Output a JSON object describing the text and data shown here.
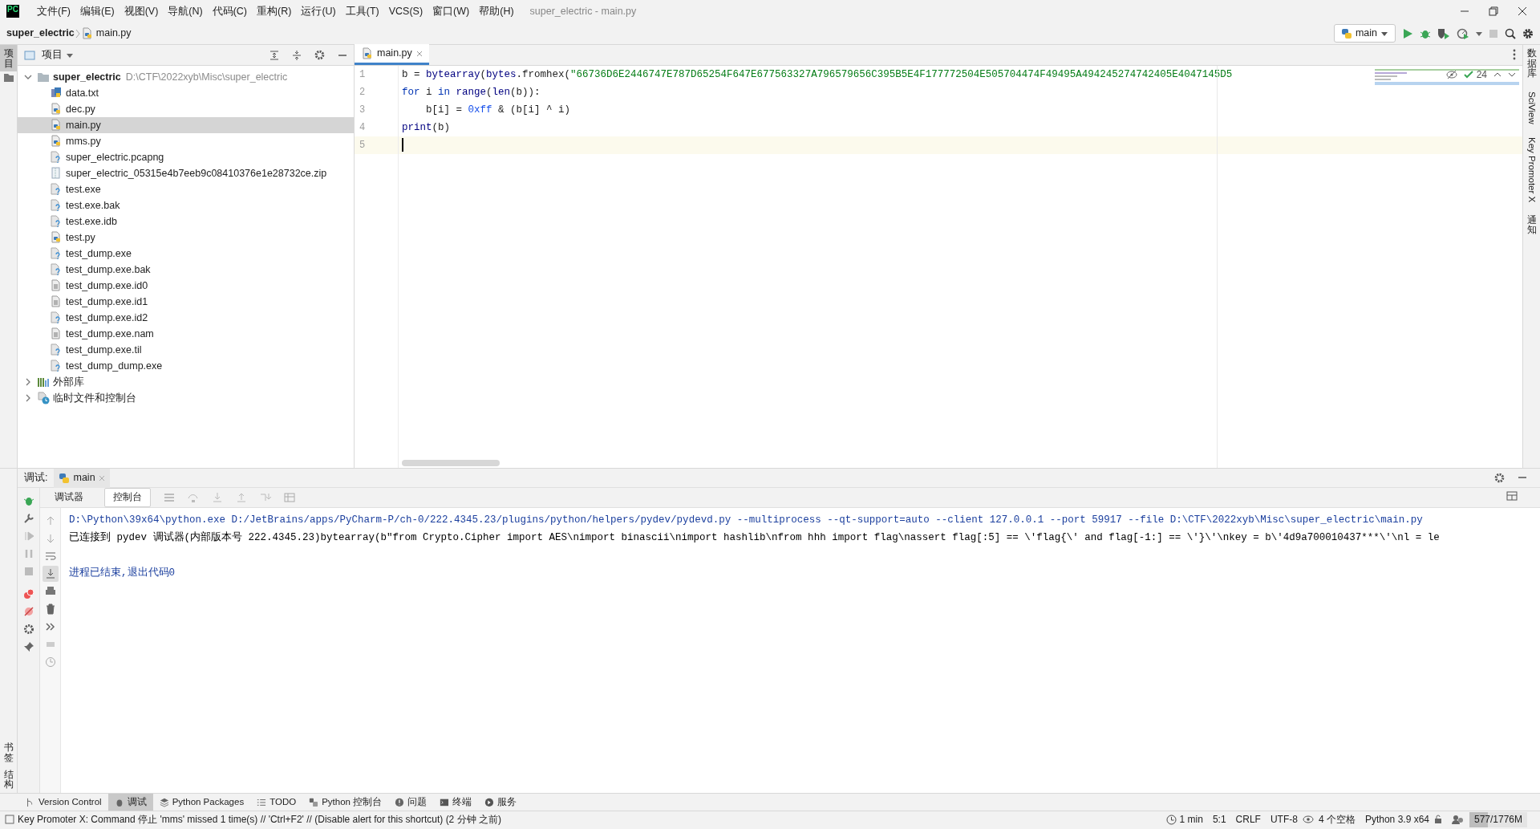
{
  "window": {
    "logo": "PC",
    "title": "super_electric - main.py"
  },
  "menu": [
    "文件(F)",
    "编辑(E)",
    "视图(V)",
    "导航(N)",
    "代码(C)",
    "重构(R)",
    "运行(U)",
    "工具(T)",
    "VCS(S)",
    "窗口(W)",
    "帮助(H)"
  ],
  "breadcrumb": [
    "super_electric",
    "main.py"
  ],
  "run_config": "main",
  "left_stripe": {
    "top": [
      {
        "label": "项目",
        "selected": true
      }
    ],
    "bottom": [
      {
        "label": "书签",
        "selected": false
      },
      {
        "label": "结构",
        "selected": false
      }
    ]
  },
  "project": {
    "title": "项目",
    "tree": [
      {
        "name": "super_electric",
        "path": "D:\\CTF\\2022xyb\\Misc\\super_electric",
        "kind": "folder",
        "expanded": true,
        "selected": false,
        "children": [
          {
            "name": "data.txt",
            "kind": "data",
            "selected": false
          },
          {
            "name": "dec.py",
            "kind": "python",
            "selected": false
          },
          {
            "name": "main.py",
            "kind": "python",
            "selected": true
          },
          {
            "name": "mms.py",
            "kind": "python",
            "selected": false
          },
          {
            "name": "super_electric.pcapng",
            "kind": "unknown",
            "selected": false
          },
          {
            "name": "super_electric_05315e4b7eeb9c08410376e1e28732ce.zip",
            "kind": "archive",
            "selected": false
          },
          {
            "name": "test.exe",
            "kind": "unknown",
            "selected": false
          },
          {
            "name": "test.exe.bak",
            "kind": "unknown",
            "selected": false
          },
          {
            "name": "test.exe.idb",
            "kind": "unknown",
            "selected": false
          },
          {
            "name": "test.py",
            "kind": "python",
            "selected": false
          },
          {
            "name": "test_dump.exe",
            "kind": "unknown",
            "selected": false
          },
          {
            "name": "test_dump.exe.bak",
            "kind": "unknown",
            "selected": false
          },
          {
            "name": "test_dump.exe.id0",
            "kind": "text",
            "selected": false
          },
          {
            "name": "test_dump.exe.id1",
            "kind": "text",
            "selected": false
          },
          {
            "name": "test_dump.exe.id2",
            "kind": "unknown",
            "selected": false
          },
          {
            "name": "test_dump.exe.nam",
            "kind": "text",
            "selected": false
          },
          {
            "name": "test_dump.exe.til",
            "kind": "unknown",
            "selected": false
          },
          {
            "name": "test_dump_dump.exe",
            "kind": "unknown",
            "selected": false
          }
        ]
      },
      {
        "name": "外部库",
        "kind": "library",
        "expanded": false,
        "selected": false
      },
      {
        "name": "临时文件和控制台",
        "kind": "scratches",
        "expanded": false,
        "selected": false
      }
    ]
  },
  "editor": {
    "tab": {
      "label": "main.py",
      "selected": true
    },
    "inspection": {
      "count": "24"
    },
    "lines": [
      {
        "number": "1",
        "current": false,
        "tokens": [
          {
            "kind": "plain",
            "text": "b = "
          },
          {
            "kind": "builtin",
            "text": "bytearray"
          },
          {
            "kind": "plain",
            "text": "("
          },
          {
            "kind": "builtin",
            "text": "bytes"
          },
          {
            "kind": "plain",
            "text": ".fromhex("
          },
          {
            "kind": "string",
            "text": "\"66736D6E2446747E787D65254F647E677563327A796579656C395B5E4F177772504E505704474F49495A494245274742405E4047145D5"
          }
        ]
      },
      {
        "number": "2",
        "current": false,
        "tokens": [
          {
            "kind": "keyword",
            "text": "for"
          },
          {
            "kind": "plain",
            "text": " i "
          },
          {
            "kind": "keyword",
            "text": "in "
          },
          {
            "kind": "builtin",
            "text": "range"
          },
          {
            "kind": "plain",
            "text": "("
          },
          {
            "kind": "builtin",
            "text": "len"
          },
          {
            "kind": "plain",
            "text": "(b)):"
          }
        ]
      },
      {
        "number": "3",
        "current": false,
        "tokens": [
          {
            "kind": "plain",
            "text": "    b[i] = "
          },
          {
            "kind": "number",
            "text": "0xff"
          },
          {
            "kind": "plain",
            "text": " & (b[i] ^ i)"
          }
        ]
      },
      {
        "number": "4",
        "current": false,
        "tokens": [
          {
            "kind": "builtin",
            "text": "print"
          },
          {
            "kind": "plain",
            "text": "(b)"
          }
        ]
      },
      {
        "number": "5",
        "current": true
      }
    ]
  },
  "right_stripe": [
    {
      "label": "数据库",
      "kind": "stacked"
    },
    {
      "label": "SciView",
      "kind": "rotated"
    },
    {
      "label": "Key Promoter X",
      "kind": "rotated"
    },
    {
      "label": "通知",
      "kind": "stacked"
    }
  ],
  "debug": {
    "label": "调试:",
    "session": {
      "label": "main",
      "selected": true
    },
    "tabs": [
      {
        "label": "调试器",
        "selected": false
      },
      {
        "label": "控制台",
        "selected": true
      }
    ],
    "console": [
      {
        "kind": "command",
        "text": "D:\\Python\\39x64\\python.exe D:/JetBrains/apps/PyCharm-P/ch-0/222.4345.23/plugins/python/helpers/pydev/pydevd.py --multiprocess --qt-support=auto --client 127.0.0.1 --port 59917 --file D:\\CTF\\2022xyb\\Misc\\super_electric\\main.py"
      },
      {
        "kind": "output",
        "text": "已连接到 pydev 调试器(内部版本号 222.4345.23)bytearray(b\"from Crypto.Cipher import AES\\nimport binascii\\nimport hashlib\\nfrom hhh import flag\\nassert flag[:5] == \\'flag{\\' and flag[-1:] == \\'}\\'\\nkey = b\\'4d9a700010437***\\'\\nl = le"
      },
      {
        "kind": "system",
        "text": "进程已结束,退出代码0"
      }
    ]
  },
  "tool_tabs": [
    {
      "label": "Version Control",
      "selected": false
    },
    {
      "label": "调试",
      "selected": true
    },
    {
      "label": "Python Packages",
      "selected": false
    },
    {
      "label": "TODO",
      "selected": false
    },
    {
      "label": "Python 控制台",
      "selected": false
    },
    {
      "label": "问题",
      "selected": false
    },
    {
      "label": "终端",
      "selected": false
    },
    {
      "label": "服务",
      "selected": false
    }
  ],
  "status": {
    "message": "Key Promoter X: Command 停止 'mms' missed 1 time(s) // 'Ctrl+F2' // (Disable alert for this shortcut) (2 分钟 之前)",
    "time": "1 min",
    "items": [
      "5:1",
      "CRLF",
      "UTF-8"
    ],
    "indent": "4 个空格",
    "interpreter": "Python 3.9 x64",
    "memory": {
      "text": "577/1776M",
      "level": 0.325
    }
  }
}
